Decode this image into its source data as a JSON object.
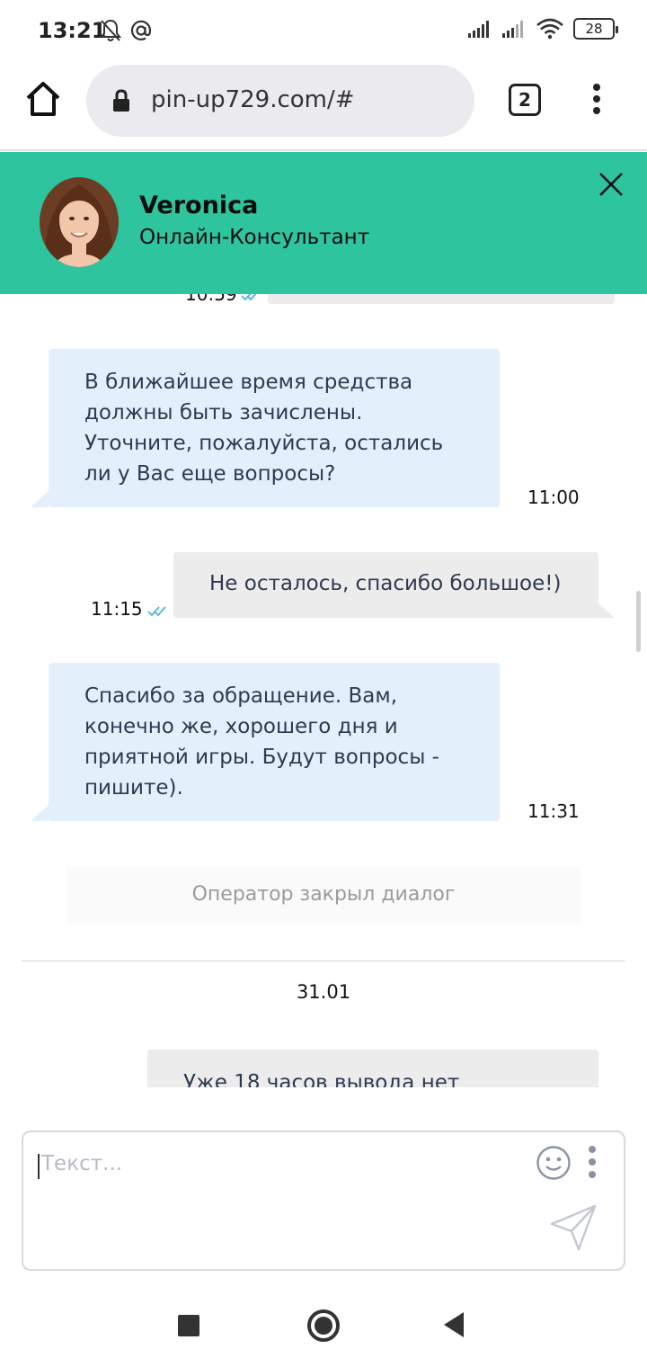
{
  "status_bar": {
    "time": "13:21",
    "battery": "28"
  },
  "browser": {
    "url": "pin-up729.com/#",
    "tab_count": "2"
  },
  "chat_header": {
    "agent_name": "Veronica",
    "agent_role": "Онлайн-Консультант"
  },
  "messages": [
    {
      "direction": "out",
      "text": "",
      "time": "10:59",
      "read": true
    },
    {
      "direction": "in",
      "text": "В ближайшее время средства должны быть зачислены. Уточните, пожалуйста, остались ли у Вас еще вопросы?",
      "time": "11:00"
    },
    {
      "direction": "out",
      "text": "Не осталось, спасибо большое!)",
      "time": "11:15",
      "read": true
    },
    {
      "direction": "in",
      "text": "Спасибо за обращение. Вам, конечно же, хорошего дня и приятной игры. Будут вопросы - пишите).",
      "time": "11:31"
    },
    {
      "direction": "out",
      "text": "Уже 18 часов вывода нет",
      "time": ""
    }
  ],
  "system_message": "Оператор закрыл диалог",
  "date_separator": "31.01",
  "input": {
    "placeholder": "Текст..."
  },
  "colors": {
    "header": "#2ec49e",
    "incoming_bubble": "#e3f0fb",
    "outgoing_bubble": "#ececec",
    "read_check": "#4fb3d9"
  }
}
